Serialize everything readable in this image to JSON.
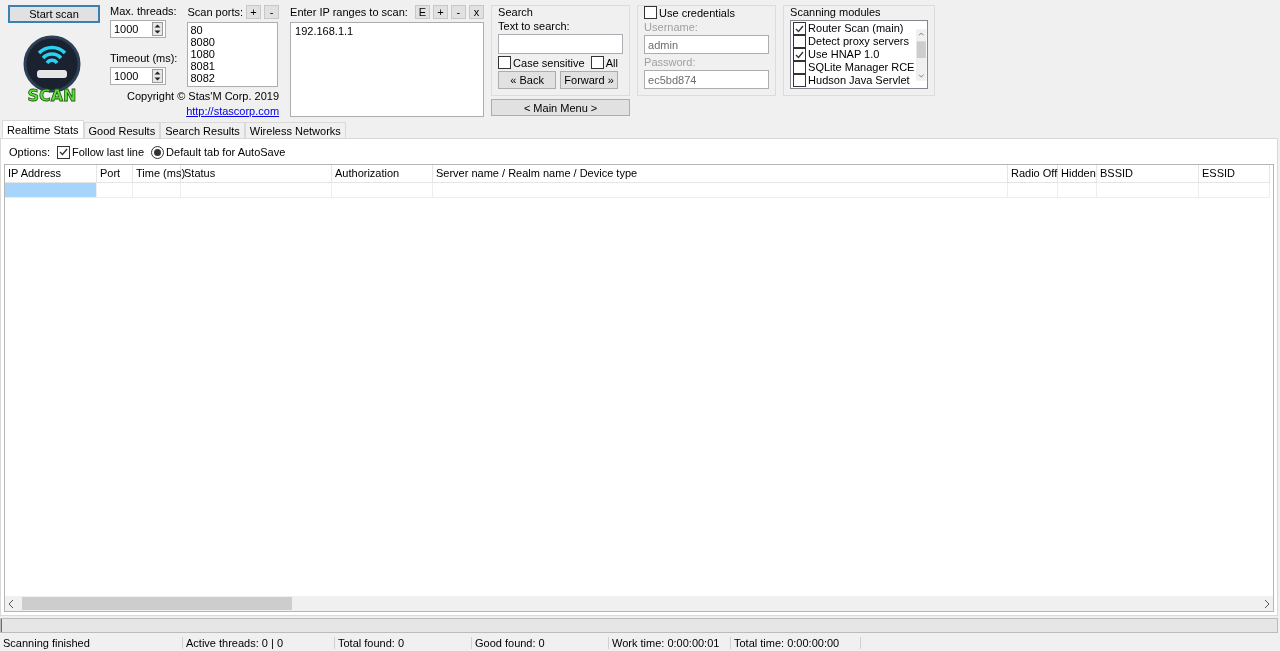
{
  "start_button": "Start scan",
  "logo": {
    "text": "SCAN"
  },
  "threads": {
    "label": "Max. threads:",
    "value": "1000"
  },
  "timeout": {
    "label": "Timeout (ms):",
    "value": "1000"
  },
  "ports": {
    "label": "Scan ports:",
    "buttons": [
      "+",
      "-"
    ],
    "items": [
      "80",
      "8080",
      "1080",
      "8081",
      "8082"
    ]
  },
  "copyright": "Copyright © Stas'M Corp. 2019",
  "link": "http://stascorp.com",
  "ip_ranges": {
    "label": "Enter IP ranges to scan:",
    "buttons": [
      "E",
      "+",
      "-",
      "x"
    ],
    "items": [
      "192.168.1.1"
    ]
  },
  "search": {
    "title": "Search",
    "label": "Text to search:",
    "options": [
      {
        "label": "Case sensitive",
        "checked": false
      },
      {
        "label": "All",
        "checked": false
      }
    ],
    "buttons": [
      "« Back",
      "Forward »"
    ]
  },
  "main_menu": "< Main Menu >",
  "credentials": {
    "label": "Use credentials",
    "checked": false,
    "username_label": "Username:",
    "username": "admin",
    "password_label": "Password:",
    "password": "ec5bd874"
  },
  "modules": {
    "title": "Scanning modules",
    "items": [
      {
        "label": "Router Scan (main)",
        "checked": true
      },
      {
        "label": "Detect proxy servers",
        "checked": false
      },
      {
        "label": "Use HNAP 1.0",
        "checked": true
      },
      {
        "label": "SQLite Manager RCE",
        "checked": false
      },
      {
        "label": "Hudson Java Servlet",
        "checked": false
      }
    ]
  },
  "tabs": [
    {
      "label": "Realtime Stats",
      "selected": true
    },
    {
      "label": "Good Results",
      "selected": false
    },
    {
      "label": "Search Results",
      "selected": false
    },
    {
      "label": "Wireless Networks",
      "selected": false
    }
  ],
  "options": {
    "label": "Options:",
    "follow": {
      "label": "Follow last line",
      "checked": true
    },
    "autosave": {
      "label": "Default tab for AutoSave",
      "selected": true
    }
  },
  "table": {
    "columns": [
      "IP Address",
      "Port",
      "Time (ms)",
      "Status",
      "Authorization",
      "Server name / Realm name / Device type",
      "Radio Off",
      "Hidden",
      "BSSID",
      "ESSID"
    ]
  },
  "progress": {
    "level": 0
  },
  "status_bar": [
    "Scanning finished",
    "Active threads: 0 | 0",
    "Total found: 0",
    "Good found: 0",
    "Work time: 0:00:00:01",
    "Total time: 0:00:00:00"
  ]
}
